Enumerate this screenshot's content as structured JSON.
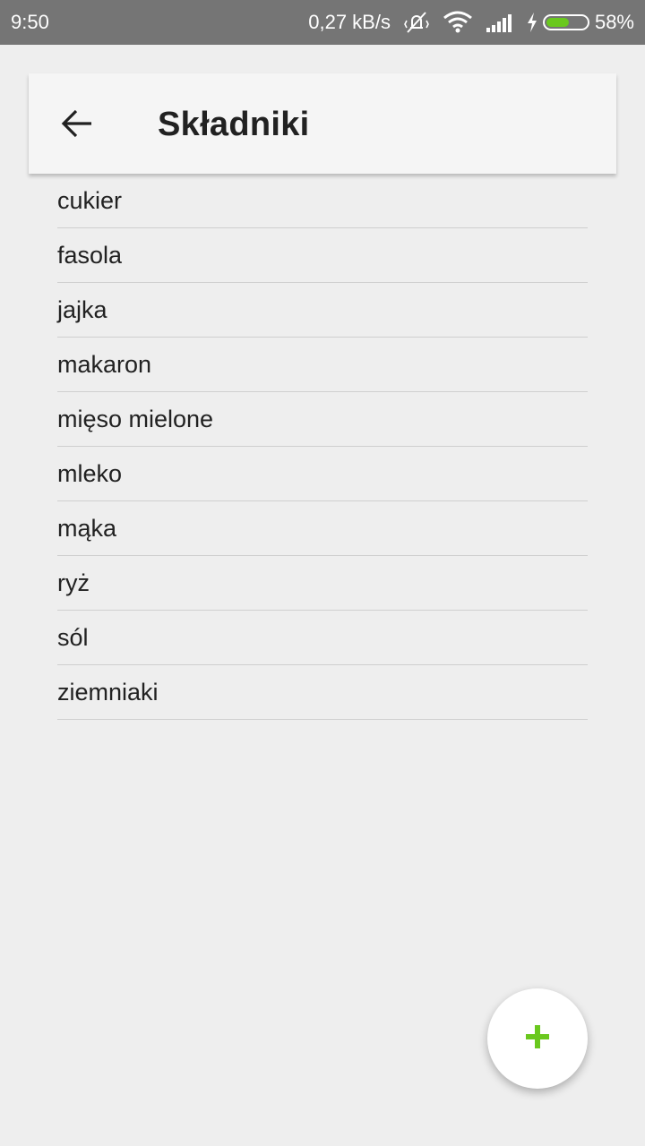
{
  "status_bar": {
    "time": "9:50",
    "network_speed": "0,27 kB/s",
    "battery_percent": "58%",
    "battery_level": 0.58,
    "battery_color": "#6ac81e",
    "icons": [
      "mute-vibrate-icon",
      "wifi-icon",
      "cellular-signal-icon",
      "charging-icon",
      "battery-icon"
    ]
  },
  "app_bar": {
    "title": "Składniki",
    "back_icon": "arrow-back-icon"
  },
  "ingredients": [
    "cukier",
    "fasola",
    "jajka",
    "makaron",
    "mięso mielone",
    "mleko",
    "mąka",
    "ryż",
    "sól",
    "ziemniaki"
  ],
  "fab": {
    "icon": "plus-icon",
    "accent_color": "#6ac81e"
  }
}
